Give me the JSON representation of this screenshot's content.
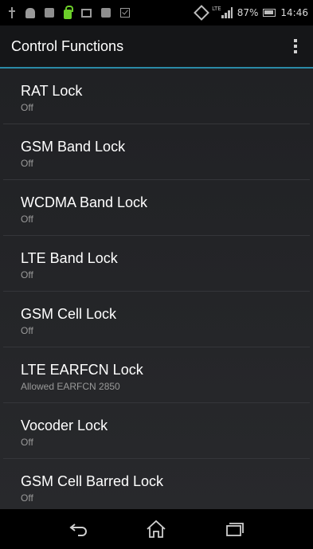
{
  "status_bar": {
    "battery_percent": "87%",
    "time": "14:46",
    "network_label": "LTE",
    "left_icons": [
      "usb-icon",
      "android-debug-icon",
      "app-notification-icon",
      "lock-icon",
      "image-icon",
      "app-notification-icon-2",
      "checkbox-icon"
    ],
    "right_icons": [
      "vibrate-icon",
      "signal-icon",
      "battery-icon"
    ]
  },
  "action_bar": {
    "title": "Control Functions",
    "menu_icon": "overflow-menu-icon",
    "accent_color": "#2a8aa6"
  },
  "preferences": [
    {
      "title": "RAT Lock",
      "summary": "Off"
    },
    {
      "title": "GSM Band Lock",
      "summary": "Off"
    },
    {
      "title": "WCDMA Band Lock",
      "summary": "Off"
    },
    {
      "title": "LTE Band Lock",
      "summary": "Off"
    },
    {
      "title": "GSM Cell Lock",
      "summary": "Off"
    },
    {
      "title": "LTE EARFCN Lock",
      "summary": "Allowed EARFCN 2850"
    },
    {
      "title": "Vocoder Lock",
      "summary": "Off"
    },
    {
      "title": "GSM Cell Barred Lock",
      "summary": "Off"
    }
  ],
  "nav_bar": {
    "icons": [
      "back-icon",
      "home-icon",
      "recent-apps-icon"
    ]
  }
}
